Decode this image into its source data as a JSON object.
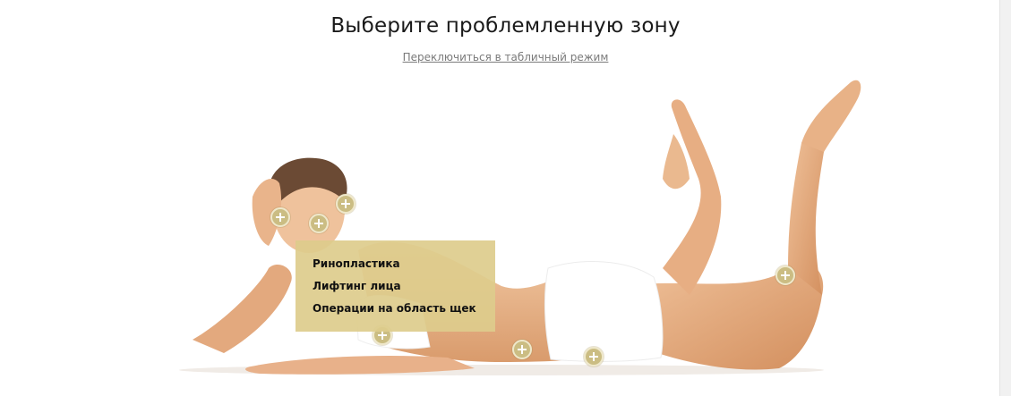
{
  "header": {
    "title": "Выберите проблемленную зону",
    "switch_link": "Переключиться в табличный режим"
  },
  "popup": {
    "items": [
      {
        "label": "Ринопластика"
      },
      {
        "label": "Лифтинг лица"
      },
      {
        "label": "Операции на область щек"
      }
    ]
  },
  "hotspots": {
    "icon": "plus-icon",
    "color": "#cbbd83",
    "count": 7
  },
  "colors": {
    "accent": "#cbbd83",
    "popup_bg": "#ddcc8c",
    "skin": "#e9b68c",
    "garment": "#ffffff"
  }
}
